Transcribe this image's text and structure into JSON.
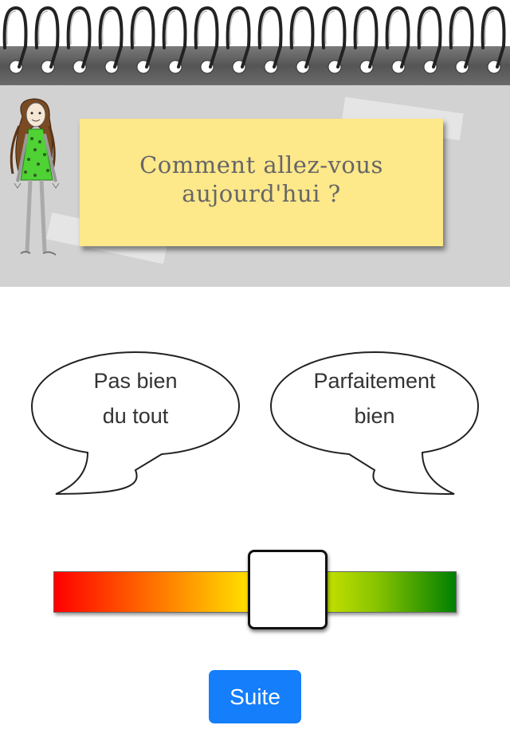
{
  "header": {
    "question_line1": "Comment allez-vous",
    "question_line2": "aujourd'hui ?"
  },
  "bubbles": {
    "left_line1": "Pas bien",
    "left_line2": "du tout",
    "right_line1": "Parfaitement",
    "right_line2": "bien"
  },
  "mood_slider": {
    "value_fraction": 0.6,
    "gradient_colors": [
      "#ff0000",
      "#ff8a00",
      "#ffff00",
      "#8ac400",
      "#008000"
    ]
  },
  "actions": {
    "next_label": "Suite"
  },
  "colors": {
    "sticky_note": "#fde88a",
    "header_background": "#d2d2d2",
    "button": "#147efb"
  }
}
